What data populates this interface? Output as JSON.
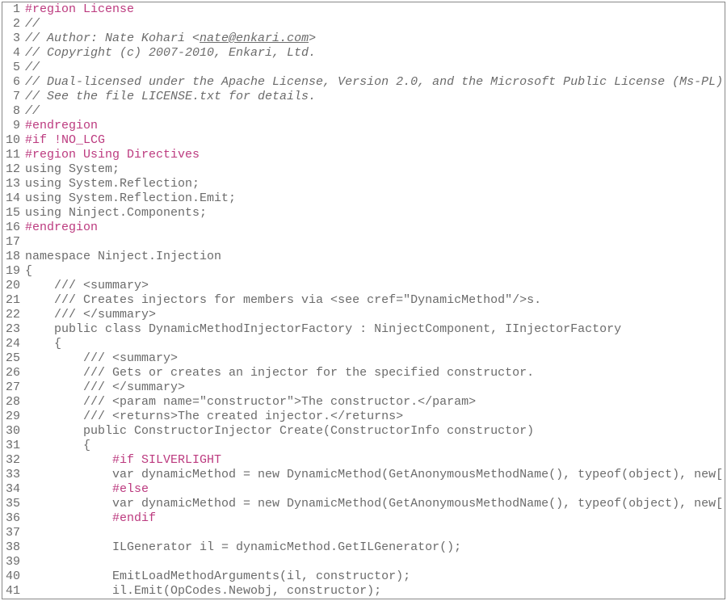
{
  "lines": [
    {
      "n": 1,
      "segments": [
        {
          "t": "#region License",
          "c": "preproc"
        }
      ]
    },
    {
      "n": 2,
      "segments": [
        {
          "t": "//",
          "c": "comment"
        }
      ]
    },
    {
      "n": 3,
      "segments": [
        {
          "t": "// Author: Nate Kohari <",
          "c": "comment"
        },
        {
          "t": "nate@enkari.com",
          "c": "comment underline"
        },
        {
          "t": ">",
          "c": "comment"
        }
      ]
    },
    {
      "n": 4,
      "segments": [
        {
          "t": "// Copyright (c) 2007-2010, Enkari, Ltd.",
          "c": "comment"
        }
      ]
    },
    {
      "n": 5,
      "segments": [
        {
          "t": "//",
          "c": "comment"
        }
      ]
    },
    {
      "n": 6,
      "segments": [
        {
          "t": "// Dual-licensed under the Apache License, Version 2.0, and the Microsoft Public License (Ms-PL).",
          "c": "comment"
        }
      ]
    },
    {
      "n": 7,
      "segments": [
        {
          "t": "// See the file LICENSE.txt for details.",
          "c": "comment"
        }
      ]
    },
    {
      "n": 8,
      "segments": [
        {
          "t": "//",
          "c": "comment"
        }
      ]
    },
    {
      "n": 9,
      "segments": [
        {
          "t": "#endregion",
          "c": "preproc"
        }
      ]
    },
    {
      "n": 10,
      "segments": [
        {
          "t": "#if !NO_LCG",
          "c": "preproc"
        }
      ]
    },
    {
      "n": 11,
      "segments": [
        {
          "t": "#region Using Directives",
          "c": "preproc"
        }
      ]
    },
    {
      "n": 12,
      "segments": [
        {
          "t": "using System;"
        }
      ]
    },
    {
      "n": 13,
      "segments": [
        {
          "t": "using System.Reflection;"
        }
      ]
    },
    {
      "n": 14,
      "segments": [
        {
          "t": "using System.Reflection.Emit;"
        }
      ]
    },
    {
      "n": 15,
      "segments": [
        {
          "t": "using Ninject.Components;"
        }
      ]
    },
    {
      "n": 16,
      "segments": [
        {
          "t": "#endregion",
          "c": "preproc"
        }
      ]
    },
    {
      "n": 17,
      "segments": [
        {
          "t": ""
        }
      ]
    },
    {
      "n": 18,
      "segments": [
        {
          "t": "namespace Ninject.Injection"
        }
      ]
    },
    {
      "n": 19,
      "segments": [
        {
          "t": "{"
        }
      ]
    },
    {
      "n": 20,
      "segments": [
        {
          "t": "    /// <summary>"
        }
      ]
    },
    {
      "n": 21,
      "segments": [
        {
          "t": "    /// Creates injectors for members via <see cref=\"DynamicMethod\"/>s."
        }
      ]
    },
    {
      "n": 22,
      "segments": [
        {
          "t": "    /// </summary>"
        }
      ]
    },
    {
      "n": 23,
      "segments": [
        {
          "t": "    public class DynamicMethodInjectorFactory : NinjectComponent, IInjectorFactory"
        }
      ]
    },
    {
      "n": 24,
      "segments": [
        {
          "t": "    {"
        }
      ]
    },
    {
      "n": 25,
      "segments": [
        {
          "t": "        /// <summary>"
        }
      ]
    },
    {
      "n": 26,
      "segments": [
        {
          "t": "        /// Gets or creates an injector for the specified constructor."
        }
      ]
    },
    {
      "n": 27,
      "segments": [
        {
          "t": "        /// </summary>"
        }
      ]
    },
    {
      "n": 28,
      "segments": [
        {
          "t": "        /// <param name=\"constructor\">The constructor.</param>"
        }
      ]
    },
    {
      "n": 29,
      "segments": [
        {
          "t": "        /// <returns>The created injector.</returns>"
        }
      ]
    },
    {
      "n": 30,
      "segments": [
        {
          "t": "        public ConstructorInjector Create(ConstructorInfo constructor)"
        }
      ]
    },
    {
      "n": 31,
      "segments": [
        {
          "t": "        {"
        }
      ]
    },
    {
      "n": 32,
      "segments": [
        {
          "t": "            "
        },
        {
          "t": "#if SILVERLIGHT",
          "c": "preproc"
        }
      ]
    },
    {
      "n": 33,
      "segments": [
        {
          "t": "            var dynamicMethod = new DynamicMethod(GetAnonymousMethodName(), typeof(object), new[]"
        }
      ]
    },
    {
      "n": 34,
      "segments": [
        {
          "t": "            "
        },
        {
          "t": "#else",
          "c": "preproc"
        }
      ]
    },
    {
      "n": 35,
      "segments": [
        {
          "t": "            var dynamicMethod = new DynamicMethod(GetAnonymousMethodName(), typeof(object), new[]"
        }
      ]
    },
    {
      "n": 36,
      "segments": [
        {
          "t": "            "
        },
        {
          "t": "#endif",
          "c": "preproc"
        }
      ]
    },
    {
      "n": 37,
      "segments": [
        {
          "t": ""
        }
      ]
    },
    {
      "n": 38,
      "segments": [
        {
          "t": "            ILGenerator il = dynamicMethod.GetILGenerator();"
        }
      ]
    },
    {
      "n": 39,
      "segments": [
        {
          "t": ""
        }
      ]
    },
    {
      "n": 40,
      "segments": [
        {
          "t": "            EmitLoadMethodArguments(il, constructor);"
        }
      ]
    },
    {
      "n": 41,
      "segments": [
        {
          "t": "            il.Emit(OpCodes.Newobj, constructor);"
        }
      ]
    }
  ]
}
